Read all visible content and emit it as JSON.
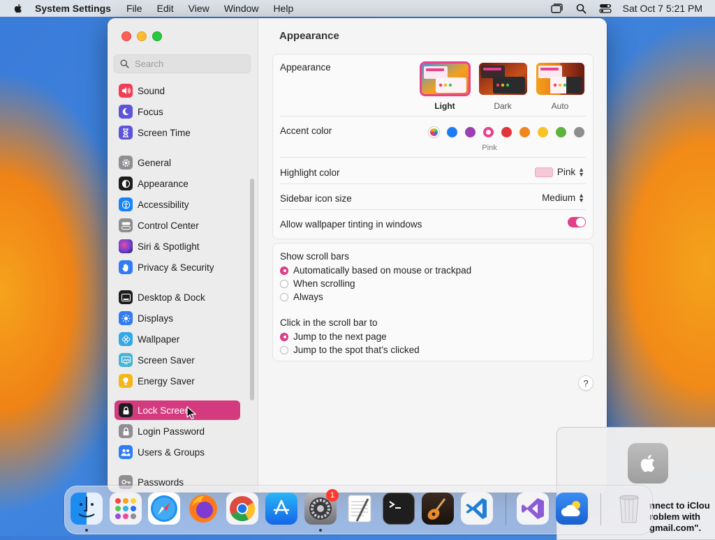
{
  "menubar": {
    "app_name": "System Settings",
    "items": [
      "File",
      "Edit",
      "View",
      "Window",
      "Help"
    ],
    "clock": "Sat Oct 7  5:21 PM"
  },
  "window": {
    "search_placeholder": "Search",
    "sidebar": {
      "selected": "Lock Screen",
      "items": [
        {
          "label": "Sound",
          "icon": "speaker-icon",
          "color": "#ef3e56"
        },
        {
          "label": "Focus",
          "icon": "moon-icon",
          "color": "#5d54d9"
        },
        {
          "label": "Screen Time",
          "icon": "hourglass-icon",
          "color": "#5d54d9"
        },
        {
          "label": "General",
          "icon": "gear-icon",
          "color": "#8e8e93"
        },
        {
          "label": "Appearance",
          "icon": "appearance-icon",
          "color": "#1c1c1e"
        },
        {
          "label": "Accessibility",
          "icon": "accessibility-icon",
          "color": "#1a82f7"
        },
        {
          "label": "Control Center",
          "icon": "control-center-icon",
          "color": "#8e8e93"
        },
        {
          "label": "Siri & Spotlight",
          "icon": "siri-icon",
          "color": "#7a3fd1"
        },
        {
          "label": "Privacy & Security",
          "icon": "hand-icon",
          "color": "#2f7cf6"
        },
        {
          "label": "Desktop & Dock",
          "icon": "dock-icon",
          "color": "#1c1c1e"
        },
        {
          "label": "Displays",
          "icon": "sun-icon",
          "color": "#2f7cf6"
        },
        {
          "label": "Wallpaper",
          "icon": "flower-icon",
          "color": "#34a7e8"
        },
        {
          "label": "Screen Saver",
          "icon": "screen-saver-icon",
          "color": "#48b5d8"
        },
        {
          "label": "Energy Saver",
          "icon": "battery-icon",
          "color": "#f5b617"
        },
        {
          "label": "Lock Screen",
          "icon": "lock-icon",
          "color": "#1c1c1e"
        },
        {
          "label": "Login Password",
          "icon": "lock-icon",
          "color": "#8e8e93"
        },
        {
          "label": "Users & Groups",
          "icon": "users-icon",
          "color": "#2f7cf6"
        },
        {
          "label": "Passwords",
          "icon": "key-icon",
          "color": "#8e8e93"
        }
      ]
    },
    "main": {
      "title": "Appearance",
      "appearance": {
        "label": "Appearance",
        "options": [
          "Light",
          "Dark",
          "Auto"
        ],
        "selected": "Light"
      },
      "accent": {
        "label": "Accent color",
        "selected_name": "Pink",
        "colors": [
          "multicolor",
          "#1e7cf2",
          "#9c3fb3",
          "#e8408d",
          "#e2353b",
          "#f0861e",
          "#f7c325",
          "#5fb23d",
          "#8e8e8e"
        ]
      },
      "highlight": {
        "label": "Highlight color",
        "value": "Pink"
      },
      "sidebar_icon_size": {
        "label": "Sidebar icon size",
        "value": "Medium"
      },
      "wallpaper_tinting": {
        "label": "Allow wallpaper tinting in windows",
        "on": true
      },
      "scroll_bars": {
        "label": "Show scroll bars",
        "options": [
          "Automatically based on mouse or trackpad",
          "When scrolling",
          "Always"
        ],
        "selected": 0
      },
      "click_scroll": {
        "label": "Click in the scroll bar to",
        "options": [
          "Jump to the next page",
          "Jump to the spot that’s clicked"
        ],
        "selected": 0
      },
      "help": "?"
    }
  },
  "notification": {
    "lines": [
      "nnect to iClou",
      "roblem with",
      "gmail.com\"."
    ]
  },
  "dock": {
    "apps": [
      "Finder",
      "Launchpad",
      "Safari",
      "Firefox",
      "Chrome",
      "App Store",
      "System Settings",
      "TextEdit",
      "Terminal",
      "GarageBand",
      "Visual Studio Code",
      "Visual Studio",
      "iCloud Drive",
      "Trash"
    ],
    "settings_badge": "1"
  }
}
